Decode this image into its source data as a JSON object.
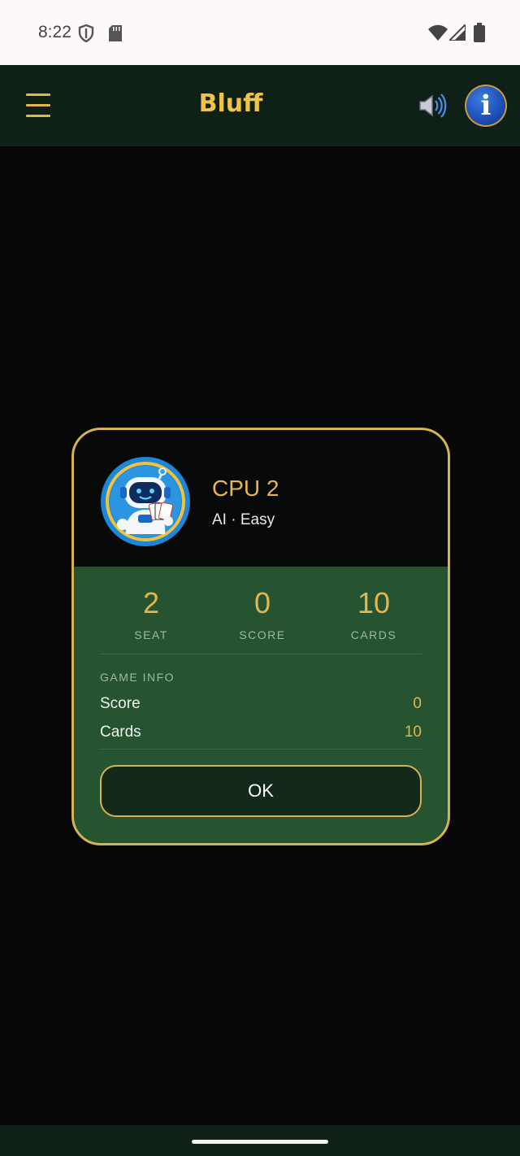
{
  "status_bar": {
    "time": "8:22",
    "icons": [
      "shield-icon",
      "sd-card-icon",
      "wifi-icon",
      "signal-icon",
      "battery-icon"
    ]
  },
  "app_bar": {
    "title": "Bluff",
    "menu_icon": "hamburger-menu-icon",
    "sound_icon": "speaker-icon",
    "info_icon": "info-icon",
    "info_glyph": "i"
  },
  "player": {
    "name": "CPU 2",
    "subtitle": "AI · Easy",
    "avatar_icon": "robot-avatar-icon"
  },
  "stats": [
    {
      "value": "2",
      "label": "SEAT"
    },
    {
      "value": "0",
      "label": "SCORE"
    },
    {
      "value": "10",
      "label": "CARDS"
    }
  ],
  "game_info": {
    "title": "GAME INFO",
    "rows": [
      {
        "label": "Score",
        "value": "0"
      },
      {
        "label": "Cards",
        "value": "10"
      }
    ]
  },
  "ok_label": "OK",
  "colors": {
    "accent_gold": "#e1b54f",
    "app_bar_bg": "#0f2116",
    "dialog_body_bg": "#265330",
    "background": "#070707"
  }
}
